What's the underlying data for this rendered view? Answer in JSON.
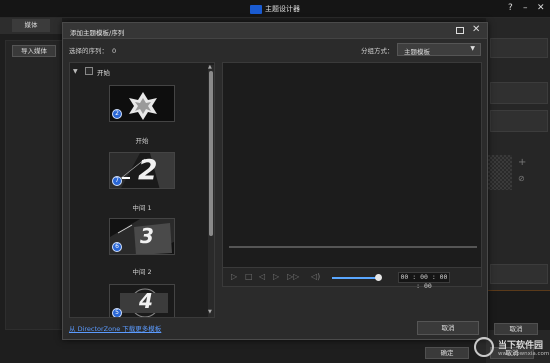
{
  "app": {
    "title": "主题设计器",
    "win_help": "?",
    "win_min": "–",
    "win_close": "✕"
  },
  "background": {
    "tab_media": "媒体",
    "import_media": "导入媒体",
    "cancel_lower": "取消",
    "ok_lower": "确定",
    "cancel_bottom": "取消"
  },
  "dialog": {
    "title": "添加主题模板/序列",
    "selected_label": "选择的序列：",
    "selected_count": "0",
    "group_label": "分组方式：",
    "group_value": "主题模板",
    "category": "开始",
    "templates": [
      {
        "label": "开始",
        "badge": "2",
        "big_number": ""
      },
      {
        "label": "中间 1",
        "badge": "7",
        "big_number": "2"
      },
      {
        "label": "中间 2",
        "badge": "6",
        "big_number": "3"
      },
      {
        "label": "",
        "badge": "5",
        "big_number": "4"
      }
    ],
    "download_link": "从 DirectorZone 下载更多模板",
    "cancel_button": "取消",
    "timecode": "00 : 00 : 00 : 00"
  },
  "watermark": {
    "name": "当下软件园",
    "url": "www.downxia.com"
  }
}
